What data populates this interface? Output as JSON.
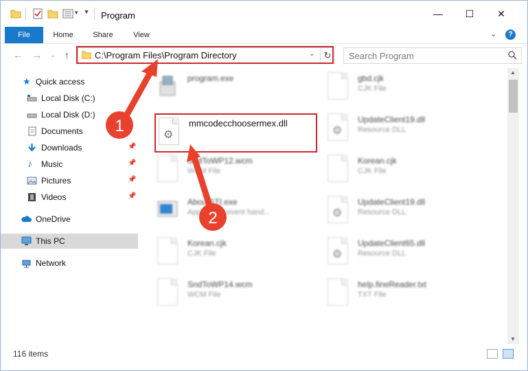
{
  "window": {
    "title": "Program",
    "controls": {
      "minimize": "—",
      "maximize": "☐",
      "close": "✕"
    }
  },
  "ribbon": {
    "tabs": [
      {
        "label": "File"
      },
      {
        "label": "Home"
      },
      {
        "label": "Share"
      },
      {
        "label": "View"
      }
    ],
    "help": "?"
  },
  "address": {
    "path": "C:\\Program Files\\Program Directory",
    "search_placeholder": "Search Program"
  },
  "navpane": {
    "items": [
      {
        "label": "Quick access"
      },
      {
        "label": "Local Disk (C:)"
      },
      {
        "label": "Local Disk (D:)"
      },
      {
        "label": "Documents"
      },
      {
        "label": "Downloads"
      },
      {
        "label": "Music"
      },
      {
        "label": "Pictures"
      },
      {
        "label": "Videos"
      },
      {
        "label": "OneDrive"
      },
      {
        "label": "This PC"
      },
      {
        "label": "Network"
      }
    ]
  },
  "files": {
    "left": [
      {
        "name": "program.exe",
        "type": ""
      },
      {
        "name": "mmcodecchoosermex.dll",
        "type": ""
      },
      {
        "name": "SndToWP12.wcm",
        "type": "WCM File"
      },
      {
        "name": "AboutSTI.exe",
        "type": "Application event hand..."
      },
      {
        "name": "Korean.cjk",
        "type": "CJK File"
      },
      {
        "name": "SndToWP14.wcm",
        "type": "WCM File"
      }
    ],
    "right": [
      {
        "name": "gbd.cjk",
        "type": "CJK File"
      },
      {
        "name": "UpdateClient19.dll",
        "type": "Resource DLL"
      },
      {
        "name": "Korean.cjk",
        "type": "CJK File"
      },
      {
        "name": "UpdateClient19.dll",
        "type": "Resource DLL"
      },
      {
        "name": "UpdateClient65.dll",
        "type": "Resource DLL"
      },
      {
        "name": "help.fineReader.txt",
        "type": "TXT File"
      }
    ]
  },
  "status": {
    "count": "116 items"
  },
  "annotations": {
    "badge1": "1",
    "badge2": "2"
  },
  "colors": {
    "accent": "#1979ca",
    "highlight": "#d0262e"
  }
}
